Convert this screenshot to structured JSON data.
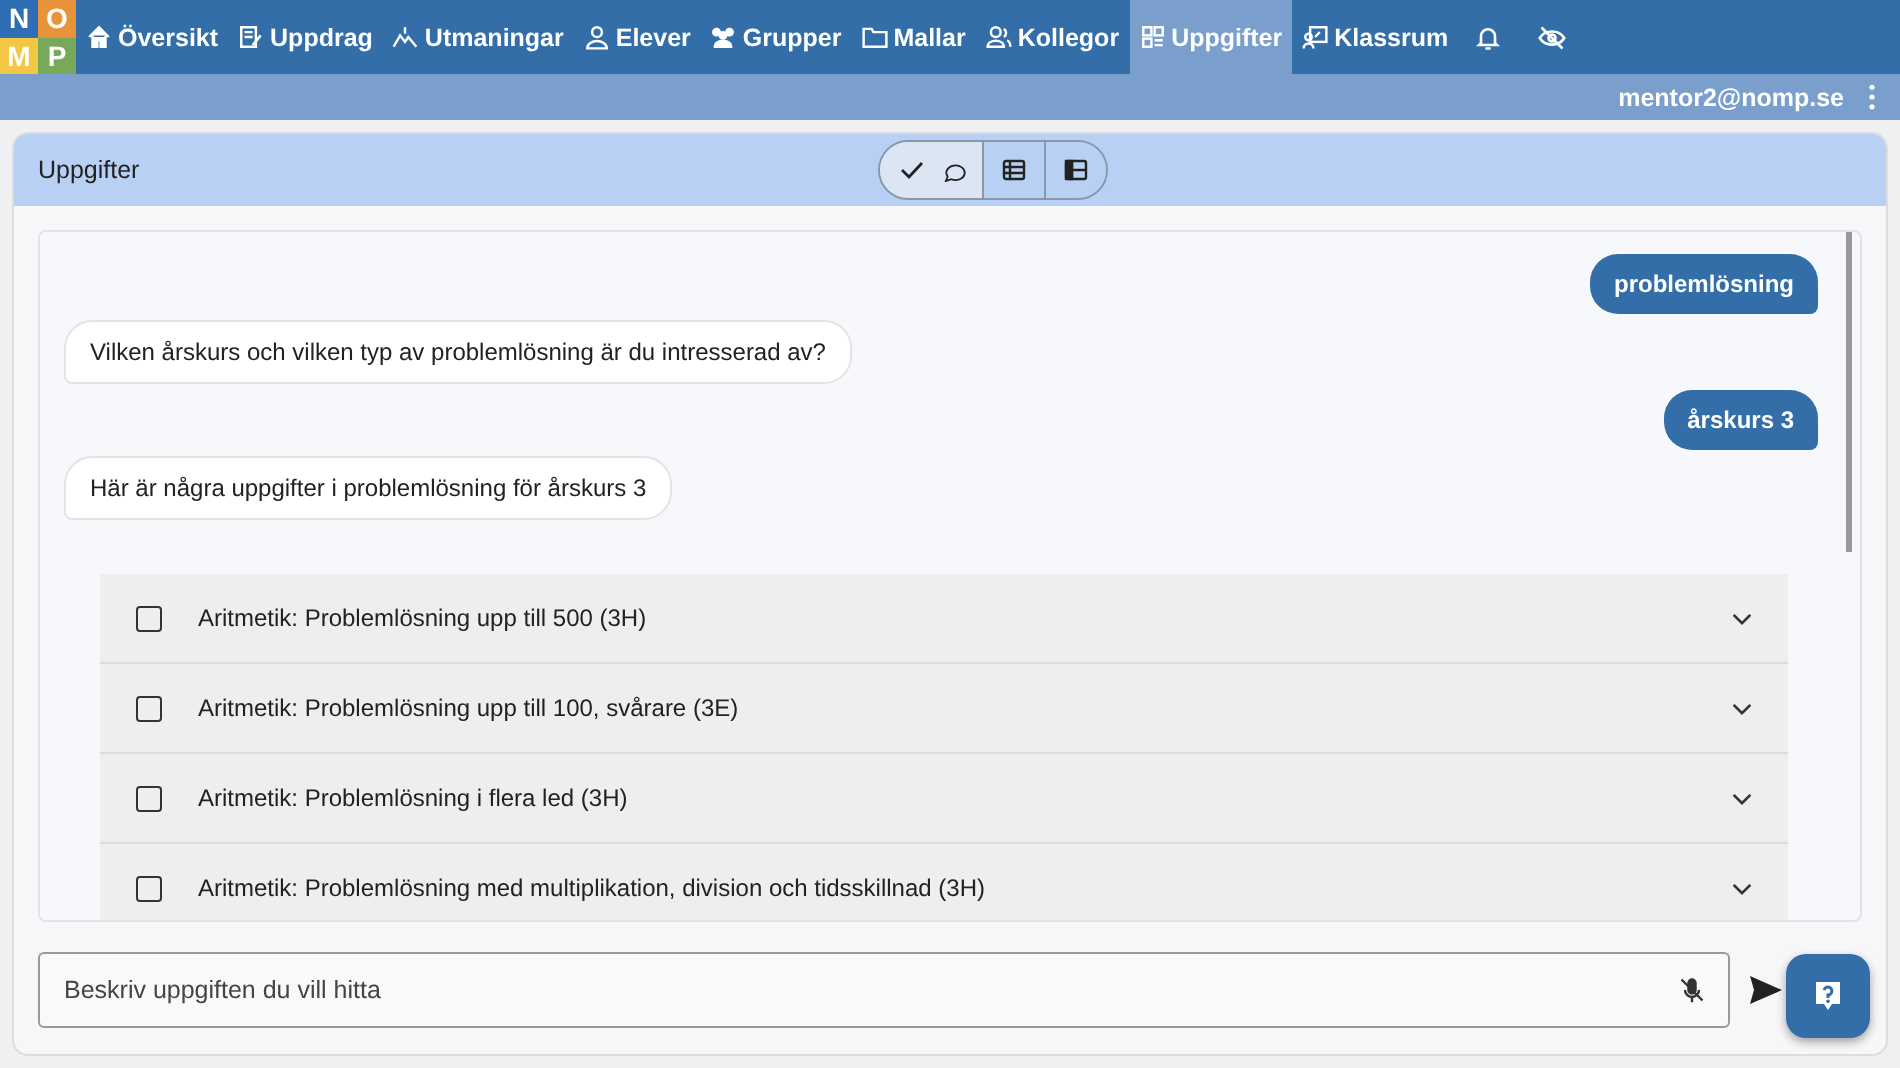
{
  "logo": {
    "letters": [
      "N",
      "O",
      "M",
      "P"
    ]
  },
  "nav": [
    {
      "label": "Översikt",
      "selected": false
    },
    {
      "label": "Uppdrag",
      "selected": false
    },
    {
      "label": "Utmaningar",
      "selected": false
    },
    {
      "label": "Elever",
      "selected": false
    },
    {
      "label": "Grupper",
      "selected": false
    },
    {
      "label": "Mallar",
      "selected": false
    },
    {
      "label": "Kollegor",
      "selected": false
    },
    {
      "label": "Uppgifter",
      "selected": true
    },
    {
      "label": "Klassrum",
      "selected": false
    }
  ],
  "user": "mentor2@nomp.se",
  "panel": {
    "title": "Uppgifter",
    "view_toggle": [
      {
        "selected": true
      },
      {
        "selected": false
      },
      {
        "selected": false
      }
    ]
  },
  "messages": [
    {
      "kind": "user",
      "text": "problemlösning"
    },
    {
      "kind": "bot",
      "text": "Vilken årskurs och vilken typ av problemlösning är du intresserad av?"
    },
    {
      "kind": "user",
      "text": "årskurs 3"
    },
    {
      "kind": "bot",
      "text": "Här är några uppgifter i problemlösning för årskurs 3"
    }
  ],
  "tasks": [
    {
      "title": "Aritmetik: Problemlösning upp till 500 (3H)",
      "checked": false
    },
    {
      "title": "Aritmetik: Problemlösning upp till 100, svårare (3E)",
      "checked": false
    },
    {
      "title": "Aritmetik: Problemlösning i flera led (3H)",
      "checked": false
    },
    {
      "title": "Aritmetik: Problemlösning med multiplikation, division och tidsskillnad (3H)",
      "checked": false
    }
  ],
  "input": {
    "placeholder": "Beskriv uppgiften du vill hitta"
  }
}
